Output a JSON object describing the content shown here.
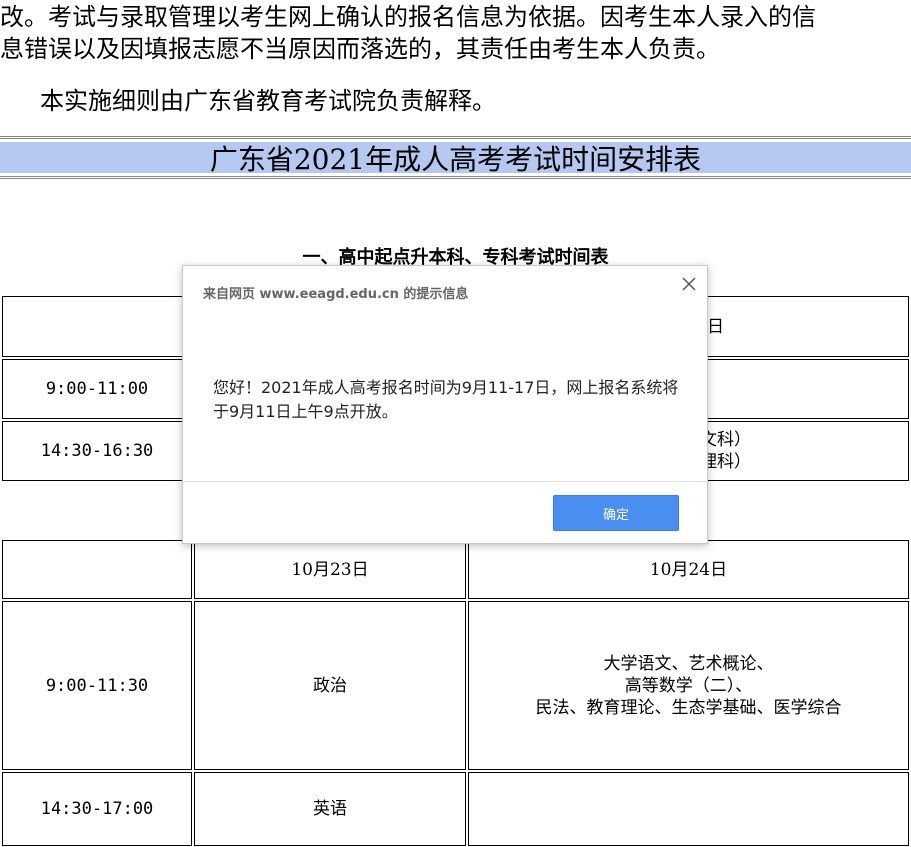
{
  "article": {
    "para1_line1": "改。考试与录取管理以考生网上确认的报名信息为依据。因考生本人录入的信",
    "para1_line2": "息错误以及因填报志愿不当原因而落选的，其责任由考生本人负责。",
    "para2": "本实施细则由广东省教育考试院负责解释。"
  },
  "schedule_title": "广东省2021年成人高考考试时间安排表",
  "table1": {
    "heading": "一、高中起点升本科、专科考试时间表",
    "header_day": "日",
    "row1_time": "9:00-11:00",
    "row2_time": "14:30-16:30",
    "row2_subject_line1": "文科）",
    "row2_subject_line2": "理科）"
  },
  "table2": {
    "header": [
      "",
      "10月23日",
      "10月24日"
    ],
    "rows": [
      {
        "time": "9:00-11:30",
        "day1": "政治",
        "day2_lines": [
          "大学语文、艺术概论、",
          "高等数学（二）、",
          "民法、教育理论、生态学基础、医学综合"
        ]
      },
      {
        "time": "14:30-17:00",
        "day1": "英语",
        "day2_lines": []
      }
    ]
  },
  "dialog": {
    "title": "来自网页 www.eeagd.edu.cn 的提示信息",
    "message": "您好！2021年成人高考报名时间为9月11-17日，网上报名系统将于9月11日上午9点开放。",
    "ok_label": "确定",
    "close_icon": "close-icon"
  },
  "colors": {
    "title_band": "#b4c8f2",
    "ok_button": "#4a8ef0"
  }
}
